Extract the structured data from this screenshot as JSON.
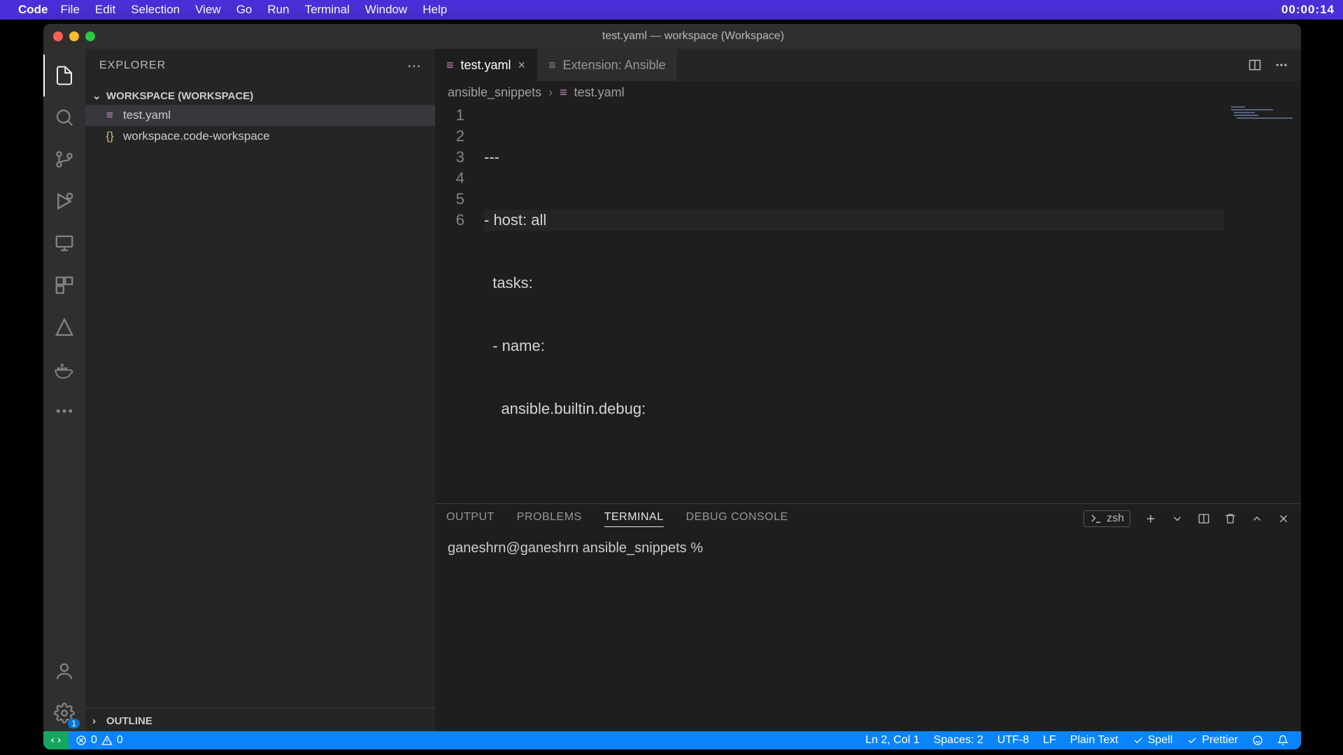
{
  "menubar": {
    "app": "Code",
    "items": [
      "File",
      "Edit",
      "Selection",
      "View",
      "Go",
      "Run",
      "Terminal",
      "Window",
      "Help"
    ],
    "clock": "00:00:14"
  },
  "window": {
    "title": "test.yaml — workspace (Workspace)"
  },
  "sidebar": {
    "title": "EXPLORER",
    "workspace_label": "WORKSPACE (WORKSPACE)",
    "files": [
      {
        "name": "test.yaml",
        "icon": "yaml",
        "active": true
      },
      {
        "name": "workspace.code-workspace",
        "icon": "json",
        "active": false
      }
    ],
    "outline_label": "OUTLINE"
  },
  "tabs": [
    {
      "label": "test.yaml",
      "active": true,
      "closable": true
    },
    {
      "label": "Extension: Ansible",
      "active": false,
      "closable": false
    }
  ],
  "breadcrumb": {
    "folder": "ansible_snippets",
    "file": "test.yaml"
  },
  "code": {
    "lines": [
      "---",
      "- host: all",
      "  tasks:",
      "  - name:",
      "    ansible.builtin.debug:",
      ""
    ],
    "highlight_line": 2
  },
  "panel": {
    "tabs": [
      "OUTPUT",
      "PROBLEMS",
      "TERMINAL",
      "DEBUG CONSOLE"
    ],
    "active_tab": "TERMINAL",
    "shell_label": "zsh",
    "prompt": "ganeshrn@ganeshrn ansible_snippets %"
  },
  "statusbar": {
    "errors": "0",
    "warnings": "0",
    "cursor": "Ln 2, Col 1",
    "indent": "Spaces: 2",
    "encoding": "UTF-8",
    "eol": "LF",
    "lang": "Plain Text",
    "spell": "Spell",
    "prettier": "Prettier"
  },
  "activity_badge": "1"
}
